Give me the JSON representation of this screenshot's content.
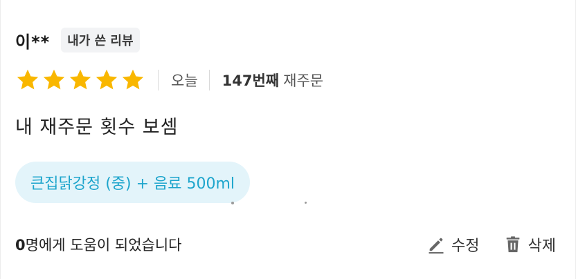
{
  "review": {
    "reviewer_name": "이**",
    "my_review_badge": "내가 쓴 리뷰",
    "rating": {
      "value": 5,
      "max": 5
    },
    "date_text": "오늘",
    "order_count_number": "147번째",
    "order_count_suffix": "재주문",
    "text": "내 재주문 횟수 보셈",
    "menu_chip": "큰집닭강정 (중) + 음료 500ml"
  },
  "footer": {
    "helpful_count": "0",
    "helpful_suffix": "명에게 도움이 되었습니다",
    "edit_label": "수정",
    "delete_label": "삭제"
  },
  "colors": {
    "star": "#f9b700",
    "chip_bg": "#e3f4fa",
    "chip_text": "#1da5cc",
    "icon": "#666666"
  },
  "icons": {
    "star": "star-icon",
    "edit": "pencil-icon",
    "delete": "trash-icon"
  }
}
